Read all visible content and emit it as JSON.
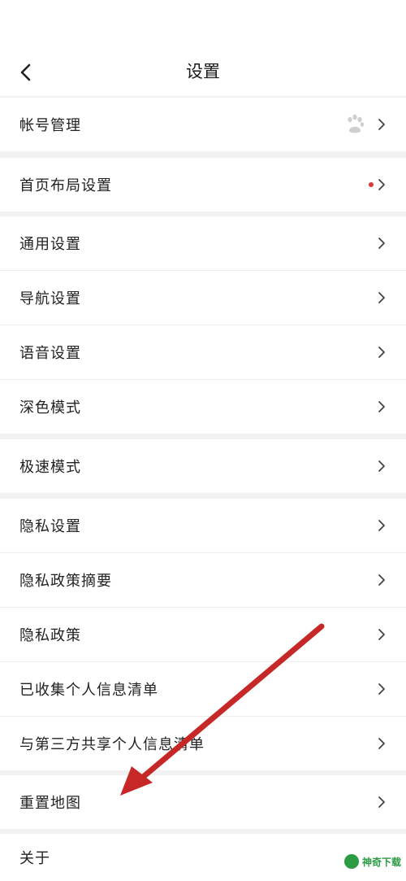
{
  "header": {
    "title": "设置"
  },
  "rows": [
    {
      "label": "帐号管理"
    },
    {
      "label": "首页布局设置"
    },
    {
      "label": "通用设置"
    },
    {
      "label": "导航设置"
    },
    {
      "label": "语音设置"
    },
    {
      "label": "深色模式"
    },
    {
      "label": "极速模式"
    },
    {
      "label": "隐私设置"
    },
    {
      "label": "隐私政策摘要"
    },
    {
      "label": "隐私政策"
    },
    {
      "label": "已收集个人信息清单"
    },
    {
      "label": "与第三方共享个人信息清单"
    },
    {
      "label": "重置地图"
    },
    {
      "label": "关于"
    }
  ],
  "watermark": {
    "text": "神奇下载"
  },
  "colors": {
    "accent_dot": "#d63a32",
    "arrow": "#c62828",
    "watermark": "#2c9c44"
  }
}
